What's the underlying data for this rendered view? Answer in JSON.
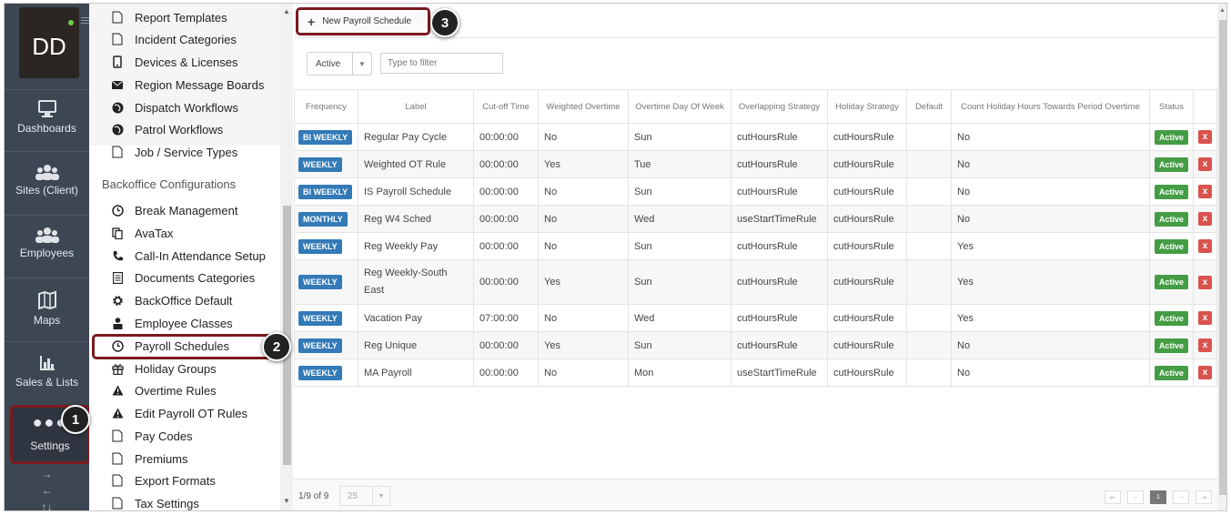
{
  "nav": {
    "avatar_initials": "DD",
    "items": [
      {
        "label": "Dashboards",
        "icon": "monitor-icon"
      },
      {
        "label": "Sites (Client)",
        "icon": "group-icon"
      },
      {
        "label": "Employees",
        "icon": "group-icon"
      },
      {
        "label": "Maps",
        "icon": "map-icon"
      },
      {
        "label": "Sales & Lists",
        "icon": "bar-chart-icon"
      },
      {
        "label": "Settings",
        "icon": "ellipsis-icon"
      }
    ],
    "arrows": [
      "→",
      "←",
      "↑↓"
    ]
  },
  "menu": {
    "top_items": [
      {
        "label": "Report Templates",
        "icon": "file-icon"
      },
      {
        "label": "Incident Categories",
        "icon": "file-icon"
      },
      {
        "label": "Devices & Licenses",
        "icon": "phone-icon"
      },
      {
        "label": "Region Message Boards",
        "icon": "envelope-icon"
      },
      {
        "label": "Dispatch Workflows",
        "icon": "globe-icon"
      },
      {
        "label": "Patrol Workflows",
        "icon": "globe-icon"
      },
      {
        "label": "Job / Service Types",
        "icon": "file-icon"
      }
    ],
    "heading": "Backoffice Configurations",
    "items": [
      {
        "label": "Break Management",
        "icon": "clock-icon"
      },
      {
        "label": "AvaTax",
        "icon": "copy-icon"
      },
      {
        "label": "Call-In Attendance Setup",
        "icon": "phone-handset-icon"
      },
      {
        "label": "Documents Categories",
        "icon": "list-icon"
      },
      {
        "label": "BackOffice Default",
        "icon": "gear-icon"
      },
      {
        "label": "Employee Classes",
        "icon": "user-icon"
      },
      {
        "label": "Payroll Schedules",
        "icon": "clock-icon"
      },
      {
        "label": "Holiday Groups",
        "icon": "gift-icon"
      },
      {
        "label": "Overtime Rules",
        "icon": "warning-icon"
      },
      {
        "label": "Edit Payroll OT Rules",
        "icon": "warning-icon"
      },
      {
        "label": "Pay Codes",
        "icon": "file-icon"
      },
      {
        "label": "Premiums",
        "icon": "file-icon"
      },
      {
        "label": "Export Formats",
        "icon": "file-icon"
      },
      {
        "label": "Tax Settings",
        "icon": "file-icon"
      }
    ]
  },
  "callouts": [
    "1",
    "2",
    "3"
  ],
  "toolbar": {
    "new_label": "New Payroll Schedule"
  },
  "filters": {
    "status_value": "Active",
    "search_placeholder": "Type to filter"
  },
  "table": {
    "headers": [
      "Frequency",
      "Label",
      "Cut-off Time",
      "Weighted Overtime",
      "Overtime Day Of Week",
      "Overlapping Strategy",
      "Holiday Strategy",
      "Default",
      "Count Holiday Hours Towards Period Overtime",
      "Status",
      ""
    ],
    "rows": [
      {
        "frequency": "BI WEEKLY",
        "label": "Regular Pay Cycle",
        "cutoff": "00:00:00",
        "weighted": "No",
        "otday": "Sun",
        "overlap": "cutHoursRule",
        "holiday": "cutHoursRule",
        "default": "",
        "count": "No",
        "status": "Active"
      },
      {
        "frequency": "WEEKLY",
        "label": "Weighted OT Rule",
        "cutoff": "00:00:00",
        "weighted": "Yes",
        "otday": "Tue",
        "overlap": "cutHoursRule",
        "holiday": "cutHoursRule",
        "default": "",
        "count": "No",
        "status": "Active"
      },
      {
        "frequency": "BI WEEKLY",
        "label": "IS Payroll Schedule",
        "cutoff": "00:00:00",
        "weighted": "No",
        "otday": "Sun",
        "overlap": "cutHoursRule",
        "holiday": "cutHoursRule",
        "default": "",
        "count": "No",
        "status": "Active"
      },
      {
        "frequency": "MONTHLY",
        "label": "Reg W4 Sched",
        "cutoff": "00:00:00",
        "weighted": "No",
        "otday": "Wed",
        "overlap": "useStartTimeRule",
        "holiday": "cutHoursRule",
        "default": "",
        "count": "No",
        "status": "Active"
      },
      {
        "frequency": "WEEKLY",
        "label": "Reg Weekly Pay",
        "cutoff": "00:00:00",
        "weighted": "No",
        "otday": "Sun",
        "overlap": "cutHoursRule",
        "holiday": "cutHoursRule",
        "default": "",
        "count": "Yes",
        "status": "Active"
      },
      {
        "frequency": "WEEKLY",
        "label": "Reg Weekly-South East",
        "cutoff": "00:00:00",
        "weighted": "Yes",
        "otday": "Sun",
        "overlap": "cutHoursRule",
        "holiday": "cutHoursRule",
        "default": "",
        "count": "Yes",
        "status": "Active"
      },
      {
        "frequency": "WEEKLY",
        "label": "Vacation Pay",
        "cutoff": "07:00:00",
        "weighted": "No",
        "otday": "Wed",
        "overlap": "cutHoursRule",
        "holiday": "cutHoursRule",
        "default": "",
        "count": "Yes",
        "status": "Active"
      },
      {
        "frequency": "WEEKLY",
        "label": "Reg Unique",
        "cutoff": "00:00:00",
        "weighted": "Yes",
        "otday": "Sun",
        "overlap": "cutHoursRule",
        "holiday": "cutHoursRule",
        "default": "",
        "count": "No",
        "status": "Active"
      },
      {
        "frequency": "WEEKLY",
        "label": "MA Payroll",
        "cutoff": "00:00:00",
        "weighted": "No",
        "otday": "Mon",
        "overlap": "useStartTimeRule",
        "holiday": "cutHoursRule",
        "default": "",
        "count": "No",
        "status": "Active"
      }
    ],
    "delete_label": "x"
  },
  "footer": {
    "count": "1/9 of 9",
    "page_size": "25",
    "pager": [
      "⇤",
      "←",
      "1",
      "→",
      "⇥"
    ]
  },
  "colors": {
    "nav_bg": "#3d4653",
    "frequency_badge": "#337ab7",
    "active_badge": "#449d44",
    "delete_button": "#d9534f",
    "callout_border": "#7b1a1f"
  }
}
